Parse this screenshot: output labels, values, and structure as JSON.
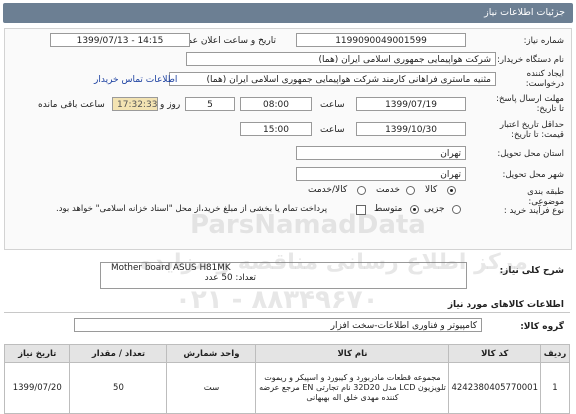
{
  "header": {
    "title": "جزئیات اطلاعات نیاز"
  },
  "fields": {
    "need_number_label": "شماره نیاز:",
    "need_number": "1199090049001599",
    "announce_label": "تاریخ و ساعت اعلان عمومی:",
    "announce_value": "1399/07/13 - 14:15",
    "buyer_label": "نام دستگاه خریدار:",
    "buyer_value": "شرکت هواپیمایی جمهوری اسلامی ایران (هما)",
    "creator_label": "ایجاد کننده درخواست:",
    "creator_value": "مثنیه ماستری فراهانی کارمند شرکت هواپیمایی جمهوری اسلامی ایران (هما)",
    "contact_link": "اطلاعات تماس خریدار",
    "deadline_label": "مهلت ارسال پاسخ: تا تاریخ:",
    "deadline_date": "1399/07/19",
    "time_label": "ساعت",
    "deadline_time": "08:00",
    "days_value": "5",
    "days_label": "روز و",
    "remaining_time": "17:32:33",
    "remaining_label": "ساعت باقی مانده",
    "validity_label": "حداقل تاریخ اعتبار قیمت: تا تاریخ:",
    "validity_date": "1399/10/30",
    "validity_time": "15:00",
    "province_label": "استان محل تحویل:",
    "province_value": "تهران",
    "city_label": "شهر محل تحویل:",
    "city_value": "تهران",
    "category_label": "طبقه بندی موضوعی:",
    "category_options": [
      "کالا",
      "خدمت",
      "کالا/خدمت"
    ],
    "process_label": "نوع فرآیند خرید :",
    "process_options": [
      "جزیی",
      "متوسط"
    ],
    "payment_note": "پرداخت تمام یا بخشی از مبلغ خرید،از محل \"اسناد خزانه اسلامی\" خواهد بود."
  },
  "description": {
    "label": "شرح کلی نیاز:",
    "line1": "Mother board ASUS H81MK",
    "line2": "تعداد: 50 عدد"
  },
  "goods_section": {
    "title": "اطلاعات کالاهای مورد نیاز"
  },
  "goods_group": {
    "label": "گروه کالا:",
    "value": "کامپیوتر و فناوری اطلاعات-سخت افزار"
  },
  "table": {
    "headers": [
      "ردیف",
      "کد کالا",
      "نام کالا",
      "واحد شمارش",
      "تعداد / مقدار",
      "تاریخ نیاز"
    ],
    "rows": [
      [
        "1",
        "4242380405770001",
        "مجموعه قطعات مادربورد و کیبورد و اسپیکر و ریموت تلویزیون LCD مدل 32D20 نام تجارتی EN مرجع عرضه کننده مهدی خلق اله بهبهانی",
        "ست",
        "50",
        "1399/07/20"
      ]
    ]
  },
  "watermark": {
    "line1": "ParsNamadData",
    "line2": "مرکز اطلاع رسانی مناقصه و مزایده",
    "line3": "۰۲۱ - ۸۸۳۴۹۶۷۰"
  }
}
